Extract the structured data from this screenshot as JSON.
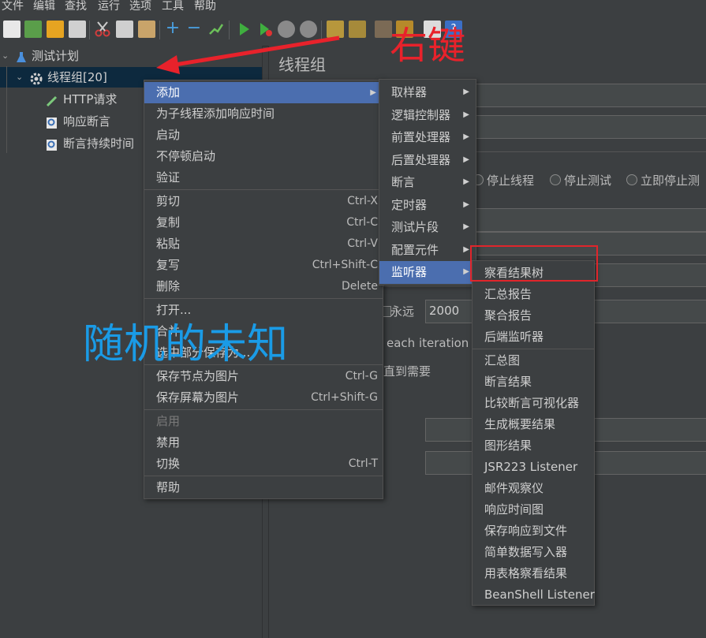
{
  "menubar": [
    "文件",
    "编辑",
    "查找",
    "运行",
    "选项",
    "工具",
    "帮助"
  ],
  "tree": {
    "plan": "测试计划",
    "group": "线程组[20]",
    "children": [
      "HTTP请求",
      "响应断言",
      "断言持续时间"
    ]
  },
  "right": {
    "title": "线程组",
    "radios": [
      "停止线程",
      "停止测试",
      "立即停止测"
    ],
    "forever": "永远",
    "loops_value": "2000",
    "each_iteration": "each iteration",
    "until_needed": "直到需要"
  },
  "context_menu": {
    "items": [
      {
        "label": "添加",
        "submenu": true,
        "highlight": true
      },
      {
        "label": "为子线程添加响应时间"
      },
      {
        "label": "启动"
      },
      {
        "label": "不停顿启动"
      },
      {
        "label": "验证"
      },
      {
        "sep": true
      },
      {
        "label": "剪切",
        "shortcut": "Ctrl-X"
      },
      {
        "label": "复制",
        "shortcut": "Ctrl-C"
      },
      {
        "label": "粘贴",
        "shortcut": "Ctrl-V"
      },
      {
        "label": "复写",
        "shortcut": "Ctrl+Shift-C"
      },
      {
        "label": "删除",
        "shortcut": "Delete"
      },
      {
        "sep": true
      },
      {
        "label": "打开..."
      },
      {
        "label": "合并"
      },
      {
        "label": "选中部分保存为..."
      },
      {
        "sep": true
      },
      {
        "label": "保存节点为图片",
        "shortcut": "Ctrl-G"
      },
      {
        "label": "保存屏幕为图片",
        "shortcut": "Ctrl+Shift-G"
      },
      {
        "sep": true
      },
      {
        "label": "启用",
        "disabled": true
      },
      {
        "label": "禁用"
      },
      {
        "label": "切换",
        "shortcut": "Ctrl-T"
      },
      {
        "sep": true
      },
      {
        "label": "帮助"
      }
    ]
  },
  "add_submenu": {
    "items": [
      {
        "label": "取样器"
      },
      {
        "label": "逻辑控制器"
      },
      {
        "label": "前置处理器"
      },
      {
        "label": "后置处理器"
      },
      {
        "label": "断言"
      },
      {
        "label": "定时器"
      },
      {
        "label": "测试片段"
      },
      {
        "label": "配置元件"
      },
      {
        "label": "监听器",
        "highlight": true
      }
    ]
  },
  "listener_submenu": {
    "items": [
      {
        "label": "察看结果树",
        "boxed": true
      },
      {
        "label": "汇总报告"
      },
      {
        "label": "聚合报告"
      },
      {
        "label": "后端监听器"
      },
      {
        "sep": true
      },
      {
        "label": "汇总图"
      },
      {
        "label": "断言结果"
      },
      {
        "label": "比较断言可视化器"
      },
      {
        "label": "生成概要结果"
      },
      {
        "label": "图形结果"
      },
      {
        "label": "JSR223 Listener"
      },
      {
        "label": "邮件观察仪"
      },
      {
        "label": "响应时间图"
      },
      {
        "label": "保存响应到文件"
      },
      {
        "label": "简单数据写入器"
      },
      {
        "label": "用表格察看结果"
      },
      {
        "label": "BeanShell Listener"
      }
    ]
  },
  "annotations": {
    "right_click": "右键",
    "random_unknown": "随机的未知",
    "arrow_color": "#e8222b",
    "blue_text_color": "#1a9be6",
    "box_color": "#e0252b"
  }
}
